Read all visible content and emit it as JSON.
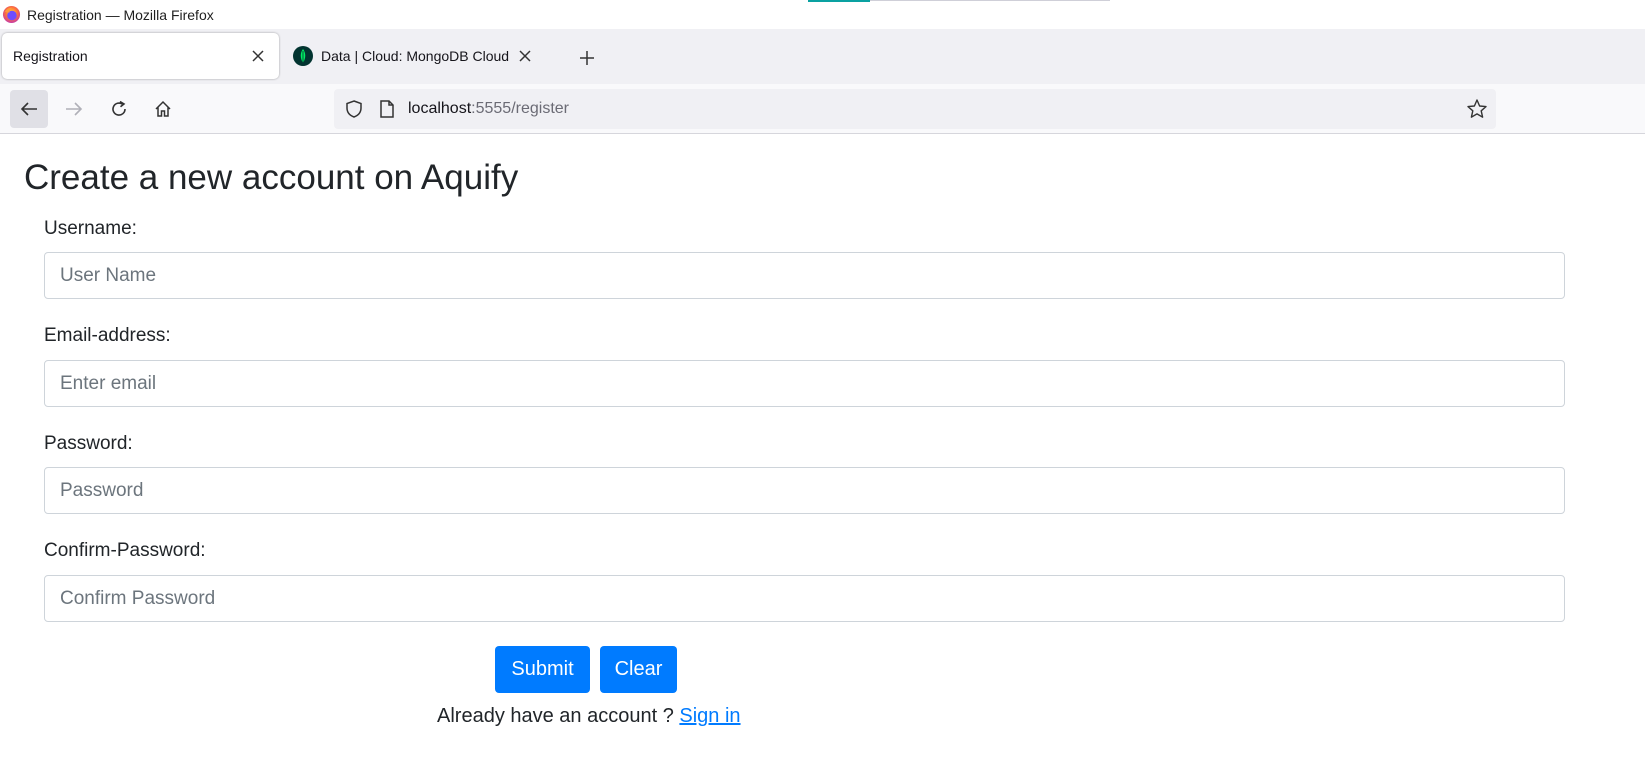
{
  "window": {
    "title": "Registration — Mozilla Firefox"
  },
  "tabs": [
    {
      "label": "Registration",
      "active": true
    },
    {
      "label": "Data | Cloud: MongoDB Cloud",
      "active": false
    }
  ],
  "navbar": {
    "url_host": "localhost",
    "url_path": ":5555/register"
  },
  "form": {
    "title": "Create a new account on Aquify",
    "username": {
      "label": "Username:",
      "placeholder": "User Name",
      "value": ""
    },
    "email": {
      "label": "Email-address:",
      "placeholder": "Enter email",
      "value": ""
    },
    "password": {
      "label": "Password:",
      "placeholder": "Password",
      "value": ""
    },
    "confirm": {
      "label": "Confirm-Password:",
      "placeholder": "Confirm Password",
      "value": ""
    },
    "submit_label": "Submit",
    "clear_label": "Clear",
    "signin_prompt": "Already have an account ? ",
    "signin_link": "Sign in"
  },
  "colors": {
    "primary": "#007bff",
    "mongodb_green": "#00ed64",
    "firefox_orange": "#ff7139"
  }
}
